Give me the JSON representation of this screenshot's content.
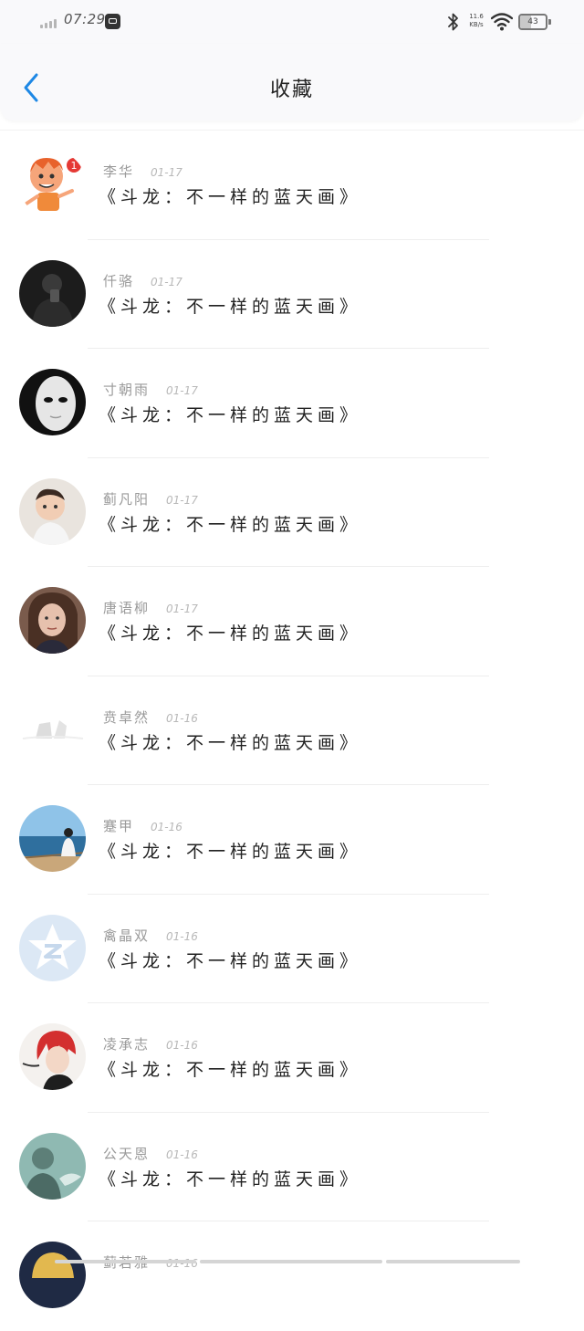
{
  "status_bar": {
    "time": "07:29",
    "net_speed_value": "11.6",
    "net_speed_unit": "KB/s",
    "battery_level": "43",
    "icons": [
      "signal-icon",
      "app-notification-icon",
      "bluetooth-icon",
      "wifi-icon",
      "battery-icon"
    ]
  },
  "header": {
    "title": "收藏",
    "back_icon": "chevron-left-icon",
    "accent_color": "#1E88E5"
  },
  "favorites": [
    {
      "author": "李华",
      "date": "01-17",
      "title": "《斗龙：不一样的蓝天画》",
      "avatar": "cartoon-boy-avatar"
    },
    {
      "author": "仟骆",
      "date": "01-17",
      "title": "《斗龙：不一样的蓝天画》",
      "avatar": "dark-portrait-avatar"
    },
    {
      "author": "寸朝雨",
      "date": "01-17",
      "title": "《斗龙：不一样的蓝天画》",
      "avatar": "white-mask-avatar"
    },
    {
      "author": "蓟凡阳",
      "date": "01-17",
      "title": "《斗龙：不一样的蓝天画》",
      "avatar": "child-photo-avatar"
    },
    {
      "author": "唐语柳",
      "date": "01-17",
      "title": "《斗龙：不一样的蓝天画》",
      "avatar": "girl-portrait-avatar"
    },
    {
      "author": "贲卓然",
      "date": "01-16",
      "title": "《斗龙：不一样的蓝天画》",
      "avatar": "faded-sketch-avatar"
    },
    {
      "author": "蹇甲",
      "date": "01-16",
      "title": "《斗龙：不一样的蓝天画》",
      "avatar": "seaside-girl-avatar"
    },
    {
      "author": "禽晶双",
      "date": "01-16",
      "title": "《斗龙：不一样的蓝天画》",
      "avatar": "default-qzone-avatar"
    },
    {
      "author": "凌承志",
      "date": "01-16",
      "title": "《斗龙：不一样的蓝天画》",
      "avatar": "anime-red-hair-avatar"
    },
    {
      "author": "公天恩",
      "date": "01-16",
      "title": "《斗龙：不一样的蓝天画》",
      "avatar": "teal-statue-avatar"
    },
    {
      "author": "蓟若雅",
      "date": "01-16",
      "title": "",
      "avatar": "blonde-partial-avatar"
    }
  ]
}
